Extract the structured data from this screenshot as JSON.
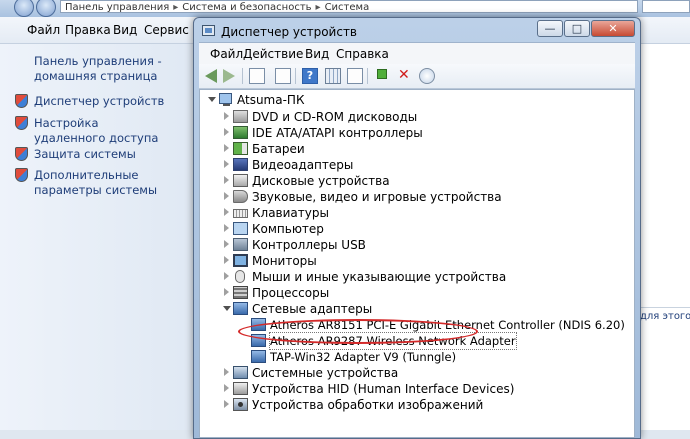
{
  "explorer": {
    "breadcrumb": [
      "Панель управления",
      "Система и безопасность",
      "Система"
    ],
    "menu": [
      "Файл",
      "Правка",
      "Вид",
      "Сервис"
    ],
    "home_link": "Панель управления - домашняя страница",
    "tasks": [
      {
        "label": "Диспетчер устройств",
        "icon": "shield-icon"
      },
      {
        "label": "Настройка удаленного доступа",
        "icon": "shield-icon"
      },
      {
        "label": "Защита системы",
        "icon": "shield-icon"
      },
      {
        "label": "Дополнительные параметры системы",
        "icon": "shield-icon"
      }
    ],
    "right_link_fragment": "для этого"
  },
  "device_manager": {
    "title": "Диспетчер устройств",
    "window_buttons": {
      "minimize": "—",
      "maximize": "□",
      "close": "✕"
    },
    "menu": [
      "Файл",
      "Действие",
      "Вид",
      "Справка"
    ],
    "toolbar_icons": [
      "back-icon",
      "forward-icon",
      "properties-icon",
      "show-hidden-icon",
      "help-icon",
      "resources-icon",
      "update-driver-icon",
      "uninstall-icon",
      "scan-hardware-icon"
    ],
    "root": "Atsuma-ПК",
    "categories": [
      {
        "label": "DVD и CD-ROM дисководы",
        "icon": "dvd-drive-icon",
        "expanded": false
      },
      {
        "label": "IDE ATA/ATAPI контроллеры",
        "icon": "ide-controller-icon",
        "expanded": false
      },
      {
        "label": "Батареи",
        "icon": "battery-icon",
        "expanded": false
      },
      {
        "label": "Видеоадаптеры",
        "icon": "display-adapter-icon",
        "expanded": false
      },
      {
        "label": "Дисковые устройства",
        "icon": "disk-drive-icon",
        "expanded": false
      },
      {
        "label": "Звуковые, видео и игровые устройства",
        "icon": "sound-icon",
        "expanded": false
      },
      {
        "label": "Клавиатуры",
        "icon": "keyboard-icon",
        "expanded": false
      },
      {
        "label": "Компьютер",
        "icon": "computer-icon",
        "expanded": false
      },
      {
        "label": "Контроллеры USB",
        "icon": "usb-icon",
        "expanded": false
      },
      {
        "label": "Мониторы",
        "icon": "monitor-icon",
        "expanded": false
      },
      {
        "label": "Мыши и иные указывающие устройства",
        "icon": "mouse-icon",
        "expanded": false
      },
      {
        "label": "Процессоры",
        "icon": "processor-icon",
        "expanded": false
      },
      {
        "label": "Сетевые адаптеры",
        "icon": "network-adapter-icon",
        "expanded": true,
        "children": [
          "Atheros AR8151 PCI-E Gigabit Ethernet Controller (NDIS 6.20)",
          "Atheros AR9287 Wireless Network Adapter",
          "TAP-Win32 Adapter V9 (Tunngle)"
        ]
      },
      {
        "label": "Системные устройства",
        "icon": "system-device-icon",
        "expanded": false
      },
      {
        "label": "Устройства HID (Human Interface Devices)",
        "icon": "hid-icon",
        "expanded": false
      },
      {
        "label": "Устройства обработки изображений",
        "icon": "imaging-device-icon",
        "expanded": false
      }
    ],
    "highlighted_device": "Atheros AR9287 Wireless Network Adapter",
    "highlight_color": "#d42a2a"
  }
}
